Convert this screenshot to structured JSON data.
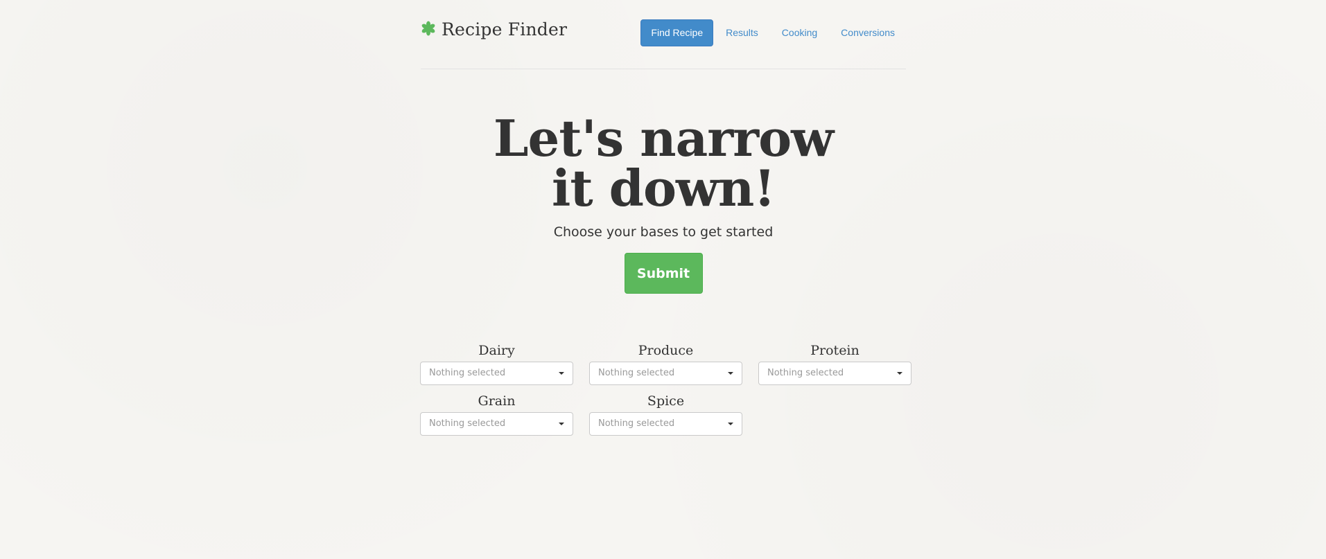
{
  "brand": {
    "title": "Recipe Finder",
    "icon": "asterisk-leaf-icon",
    "icon_color": "#5cb85c"
  },
  "nav": {
    "items": [
      {
        "label": "Find Recipe",
        "active": true
      },
      {
        "label": "Results",
        "active": false
      },
      {
        "label": "Cooking",
        "active": false
      },
      {
        "label": "Conversions",
        "active": false
      }
    ]
  },
  "hero": {
    "title": "Let's narrow it down!",
    "subtitle": "Choose your bases to get started",
    "submit_label": "Submit"
  },
  "filters": [
    {
      "label": "Dairy",
      "value": "Nothing selected"
    },
    {
      "label": "Produce",
      "value": "Nothing selected"
    },
    {
      "label": "Protein",
      "value": "Nothing selected"
    },
    {
      "label": "Grain",
      "value": "Nothing selected"
    },
    {
      "label": "Spice",
      "value": "Nothing selected"
    }
  ],
  "colors": {
    "primary": "#428bca",
    "success": "#5cb85c",
    "background": "#f6f5f2"
  }
}
